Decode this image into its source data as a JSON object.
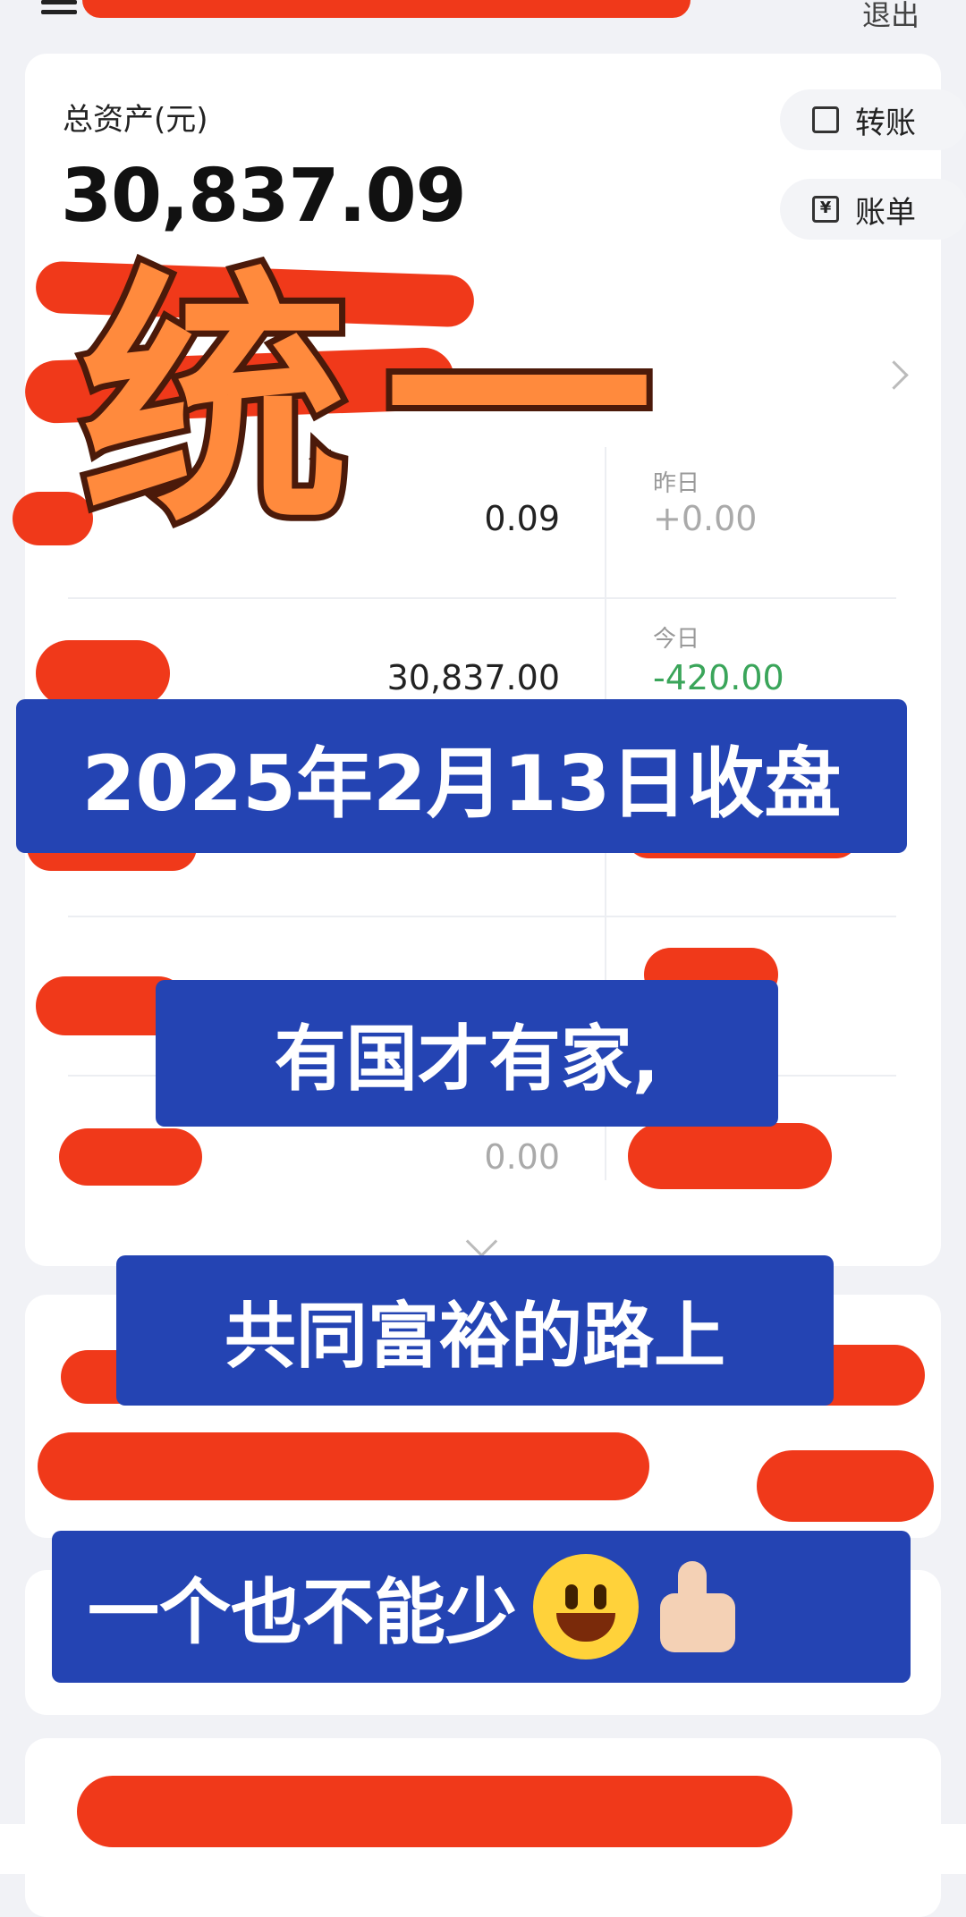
{
  "header": {
    "logout_label": "退出"
  },
  "assets": {
    "label": "总资产(元)",
    "total_value": "30,837.09",
    "transfer_label": "转账",
    "bill_label": "账单",
    "bill_icon_glyph": "¥"
  },
  "accounts": [
    {
      "amount": "0.09",
      "change_label": "昨日",
      "change": "+0.00"
    },
    {
      "amount": "30,837.00",
      "change_label": "今日",
      "change": "-420.00"
    },
    {
      "amount": "0.00",
      "change_label": "",
      "change": ""
    },
    {
      "amount": "0.00",
      "change_label": "",
      "change": ""
    }
  ],
  "overlay": {
    "big_title": "统一",
    "banner_date": "2025年2月13日收盘",
    "banner_line2": "有国才有家,",
    "banner_line3": "共同富裕的路上",
    "banner_line4": "一个也不能少"
  },
  "colors": {
    "banner_blue": "#2444b3",
    "title_orange": "#ff8a3d",
    "redaction_red": "#f0391a",
    "negative_green": "#3aa55a"
  },
  "icons": [
    "menu-icon",
    "transfer-icon",
    "bill-icon",
    "chevron-right-icon",
    "chevron-down-icon",
    "smiley-emoji-icon",
    "thumbs-up-emoji-icon"
  ]
}
